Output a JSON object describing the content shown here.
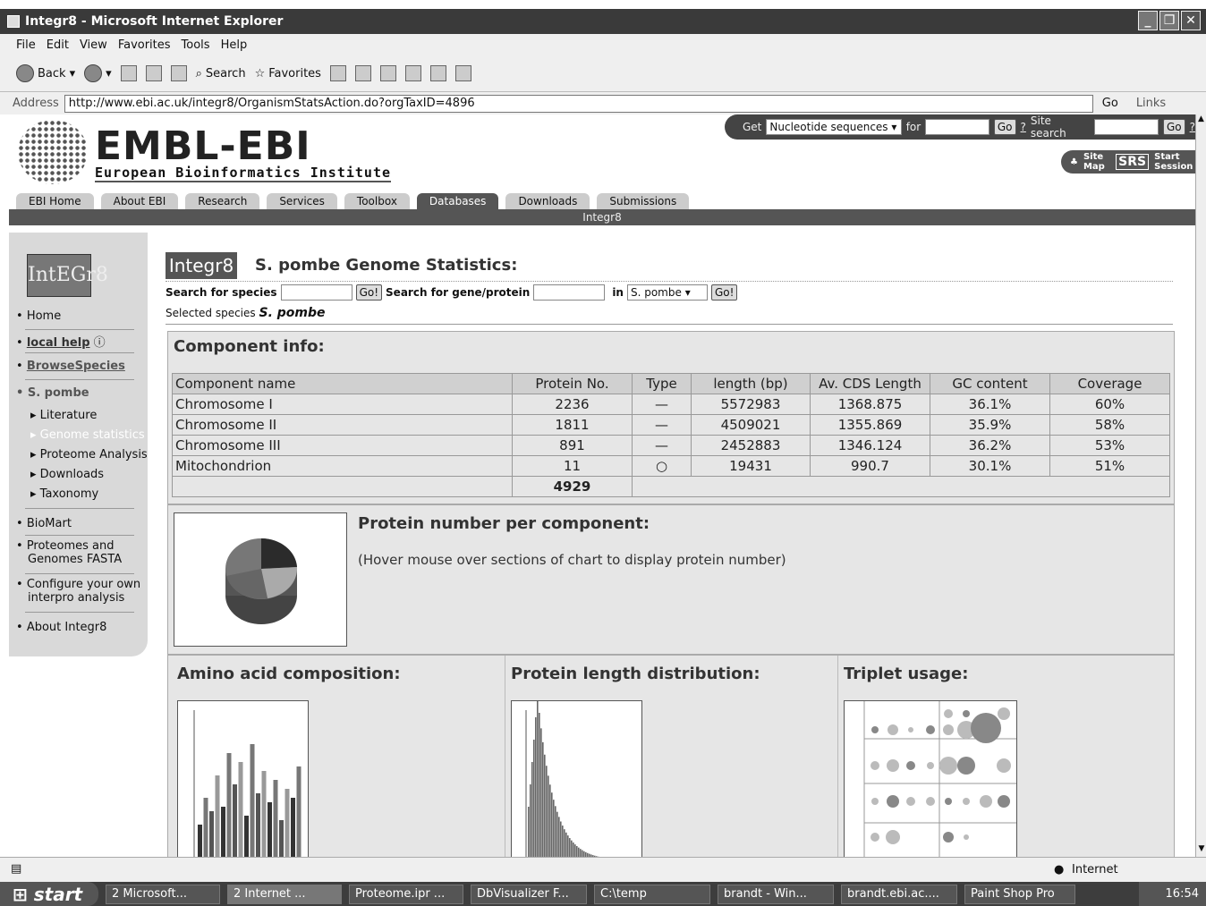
{
  "window": {
    "title": "Integr8 - Microsoft Internet Explorer"
  },
  "menu": [
    "File",
    "Edit",
    "View",
    "Favorites",
    "Tools",
    "Help"
  ],
  "toolbar": {
    "back": "Back",
    "search": "Search",
    "favorites": "Favorites"
  },
  "address": {
    "label": "Address",
    "url": "http://www.ebi.ac.uk/integr8/OrganismStatsAction.do?orgTaxID=4896",
    "go": "Go",
    "links": "Links"
  },
  "ebi": {
    "logo": "EMBL-EBI",
    "subtitle": "European Bioinformatics Institute",
    "get_label": "Get",
    "get_value": "Nucleotide sequences",
    "for_label": "for",
    "go": "Go",
    "help": "?",
    "site_search": "Site search",
    "site_map": "Site Map",
    "srs": "SRS",
    "start_session": "Start Session",
    "tabs": [
      "EBI Home",
      "About EBI",
      "Research",
      "Services",
      "Toolbox",
      "Databases",
      "Downloads",
      "Submissions"
    ],
    "active_tab": "Databases",
    "subbar": "Integr8"
  },
  "sidebar": {
    "logo": "IntEGr8",
    "home": "Home",
    "local_help": "local help",
    "browse": "BrowseSpecies",
    "species": "S. pombe",
    "sub": [
      "Literature",
      "Genome statistics",
      "Proteome Analysis",
      "Downloads",
      "Taxonomy"
    ],
    "biomart": "BioMart",
    "proteomes": "Proteomes and Genomes FASTA",
    "configure": "Configure your own interpro analysis",
    "about": "About Integr8"
  },
  "main": {
    "badge": "Integr8",
    "title": "S. pombe Genome Statistics:",
    "search_species": "Search for species",
    "go": "Go!",
    "search_gene": "Search for gene/protein",
    "in": "in",
    "species_select": "S. pombe",
    "selected_label": "Selected species",
    "selected_value": "S. pombe"
  },
  "component": {
    "heading": "Component info:",
    "headers": [
      "Component name",
      "Protein No.",
      "Type",
      "length (bp)",
      "Av. CDS Length",
      "GC content",
      "Coverage"
    ],
    "rows": [
      [
        "Chromosome I",
        "2236",
        "—",
        "5572983",
        "1368.875",
        "36.1%",
        "60%"
      ],
      [
        "Chromosome II",
        "1811",
        "—",
        "4509021",
        "1355.869",
        "35.9%",
        "58%"
      ],
      [
        "Chromosome III",
        "891",
        "—",
        "2452883",
        "1346.124",
        "36.2%",
        "53%"
      ],
      [
        "Mitochondrion",
        "11",
        "○",
        "19431",
        "990.7",
        "30.1%",
        "51%"
      ]
    ],
    "total": "4929"
  },
  "pie": {
    "heading": "Protein number per component:",
    "hint": "(Hover mouse over sections of chart to display protein number)"
  },
  "bottom": {
    "amino": "Amino acid composition:",
    "length": "Protein length distribution:",
    "triplet": "Triplet usage:"
  },
  "status": {
    "zone": "Internet"
  },
  "taskbar": {
    "start": "start",
    "tasks": [
      "2 Microsoft...",
      "2 Internet ...",
      "Proteome.ipr ...",
      "DbVisualizer F...",
      "C:\\temp",
      "brandt - Win...",
      "brandt.ebi.ac....",
      "Paint Shop Pro"
    ],
    "clock": "16:54"
  }
}
